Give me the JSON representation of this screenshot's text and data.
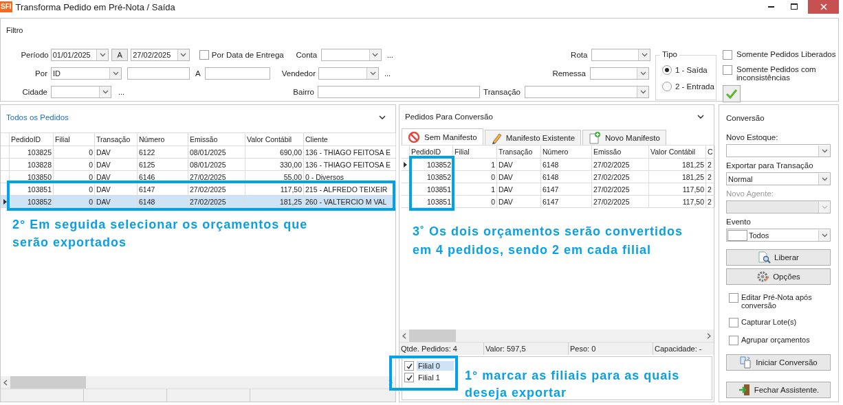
{
  "window": {
    "logo": "SFI",
    "title": "Transforma Pedido em Pré-Nota / Saída"
  },
  "filter": {
    "title": "Filtro",
    "period": {
      "label": "Período",
      "from": "01/01/2025",
      "range_button": "A",
      "to": "27/02/2025"
    },
    "by_delivery_date": {
      "label": "Por Data de Entrega",
      "checked": false
    },
    "account": {
      "label": "Conta",
      "more": "..."
    },
    "route": {
      "label": "Rota"
    },
    "by": {
      "label": "Por",
      "value": "ID",
      "range_label": "A"
    },
    "seller": {
      "label": "Vendedor",
      "more": "..."
    },
    "shipment": {
      "label": "Remessa"
    },
    "city": {
      "label": "Cidade",
      "more": "..."
    },
    "district": {
      "label": "Bairro"
    },
    "transaction": {
      "label": "Transação"
    },
    "type": {
      "title": "Tipo",
      "options": [
        {
          "label": "1 - Saída",
          "selected": true
        },
        {
          "label": "2 - Entrada",
          "selected": false
        }
      ]
    },
    "options": [
      {
        "label": "Somente Pedidos Liberados",
        "checked": false
      },
      {
        "label": "Somente Pedidos com inconsistências",
        "checked": false
      }
    ]
  },
  "all_orders": {
    "title": "Todos os Pedidos",
    "columns": [
      "PedidoID",
      "Filial",
      "Transação",
      "Número",
      "Emissão",
      "Valor Contábil",
      "Cliente"
    ],
    "rows": [
      {
        "selected": false,
        "cells": [
          "103825",
          "0",
          "DAV",
          "6122",
          "08/01/2025",
          "690,00",
          "136 - THIAGO FEITOSA E"
        ]
      },
      {
        "selected": false,
        "cells": [
          "103828",
          "0",
          "DAV",
          "6125",
          "08/01/2025",
          "330,00",
          "136 - THIAGO FEITOSA E"
        ]
      },
      {
        "selected": false,
        "cells": [
          "103850",
          "0",
          "DAV",
          "6146",
          "27/02/2025",
          "55,00",
          "0 - Diversos"
        ]
      },
      {
        "selected": false,
        "cells": [
          "103851",
          "0",
          "DAV",
          "6147",
          "27/02/2025",
          "117,50",
          "215 - ALFREDO TEIXEIR"
        ]
      },
      {
        "selected": true,
        "cells": [
          "103852",
          "0",
          "DAV",
          "6148",
          "27/02/2025",
          "181,25",
          "260 - VALTERCIO M VAL"
        ]
      }
    ]
  },
  "conversion_orders": {
    "title": "Pedidos Para Conversão",
    "tabs": [
      {
        "label": "Sem Manifesto",
        "selected": true
      },
      {
        "label": "Manifesto Existente",
        "selected": false
      },
      {
        "label": "Novo Manifesto",
        "selected": false
      }
    ],
    "columns": [
      "PedidoID",
      "Filial",
      "Transação",
      "Número",
      "Emissão",
      "Valor Contábil",
      "C"
    ],
    "rows": [
      {
        "current": true,
        "cells": [
          "103852",
          "1",
          "DAV",
          "6148",
          "27/02/2025",
          "181,25",
          "2"
        ]
      },
      {
        "current": false,
        "cells": [
          "103852",
          "0",
          "DAV",
          "6148",
          "27/02/2025",
          "181,25",
          "2"
        ]
      },
      {
        "current": false,
        "cells": [
          "103851",
          "1",
          "DAV",
          "6147",
          "27/02/2025",
          "117,50",
          "2"
        ]
      },
      {
        "current": false,
        "cells": [
          "103851",
          "0",
          "DAV",
          "6147",
          "27/02/2025",
          "117,50",
          "2"
        ]
      }
    ],
    "status": [
      "Qtde. Pedidos: 4",
      "Valor: 597,5",
      "Peso: 0",
      "Capacidade: -"
    ],
    "branches": [
      {
        "label": "Filial 0",
        "checked": true,
        "selected": true
      },
      {
        "label": "Filial 1",
        "checked": true,
        "selected": false
      }
    ]
  },
  "conversion": {
    "title": "Conversão",
    "fields": [
      {
        "label": "Novo Estoque:",
        "disabled": false
      },
      {
        "label": "Exportar para Transação",
        "value": "Normal",
        "disabled": false
      },
      {
        "label": "Novo Agente:",
        "disabled": true
      },
      {
        "label": "Evento",
        "value": "Todos",
        "disabled": false,
        "swatch": true
      }
    ],
    "buttons": [
      {
        "label": "Liberar",
        "kind": "release"
      },
      {
        "label": "Opções",
        "kind": "options"
      }
    ],
    "checks": [
      {
        "label": "Editar Pré-Nota após conversão",
        "checked": false
      },
      {
        "label": "Capturar Lote(s)",
        "checked": false
      },
      {
        "label": "Agrupar orçamentos",
        "checked": false
      }
    ],
    "actions": [
      {
        "label": "Iniciar Conversão",
        "kind": "start"
      },
      {
        "label": "Fechar Assistente.",
        "kind": "close"
      }
    ]
  },
  "annotations": [
    {
      "text": "2° Em seguida selecionar os orçamentos que serão exportados"
    },
    {
      "text": "3˚ Os dois orçamentos serão convertidos em 4 pedidos, sendo 2 em cada filial"
    },
    {
      "text": "1° marcar as filiais para as quais deseja exportar"
    }
  ]
}
